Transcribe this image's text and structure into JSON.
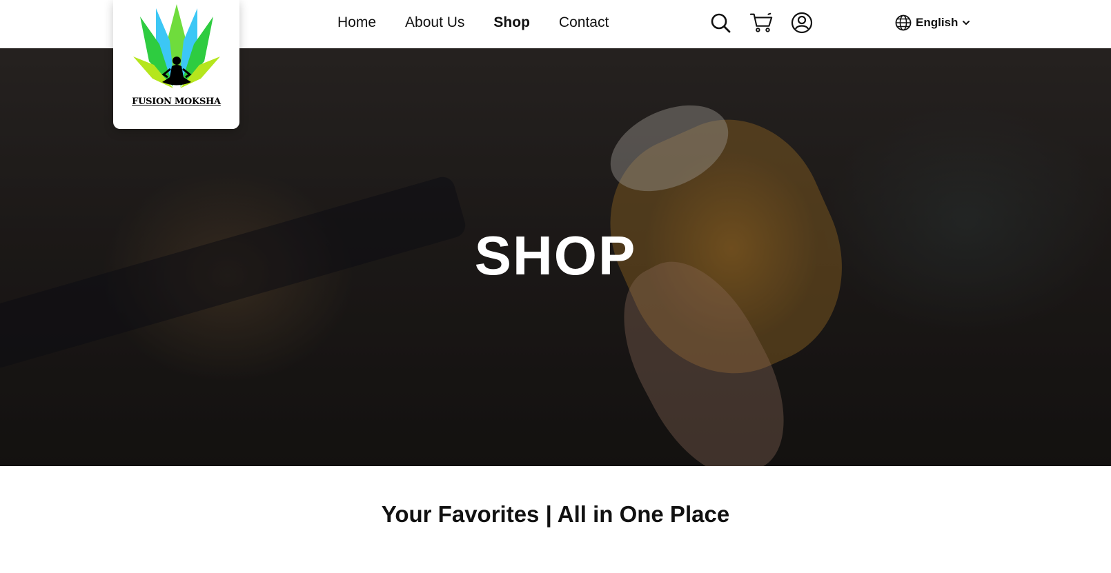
{
  "brand": {
    "name": "FUSION MOKSHA"
  },
  "nav": {
    "items": [
      {
        "label": "Home",
        "active": false
      },
      {
        "label": "About Us",
        "active": false
      },
      {
        "label": "Shop",
        "active": true
      },
      {
        "label": "Contact",
        "active": false
      }
    ]
  },
  "header_icons": [
    "search-icon",
    "cart-icon",
    "user-account-icon"
  ],
  "language": {
    "label": "English",
    "icon": "globe-icon",
    "caret": "chevron-down-icon"
  },
  "hero": {
    "title": "SHOP"
  },
  "section": {
    "title": "Your Favorites | All in One Place"
  },
  "colors": {
    "text": "#111111",
    "hero_text": "#ffffff",
    "logo_green": "#2ecc40",
    "logo_lime": "#b5e61d",
    "logo_cyan": "#3cc7f5"
  }
}
